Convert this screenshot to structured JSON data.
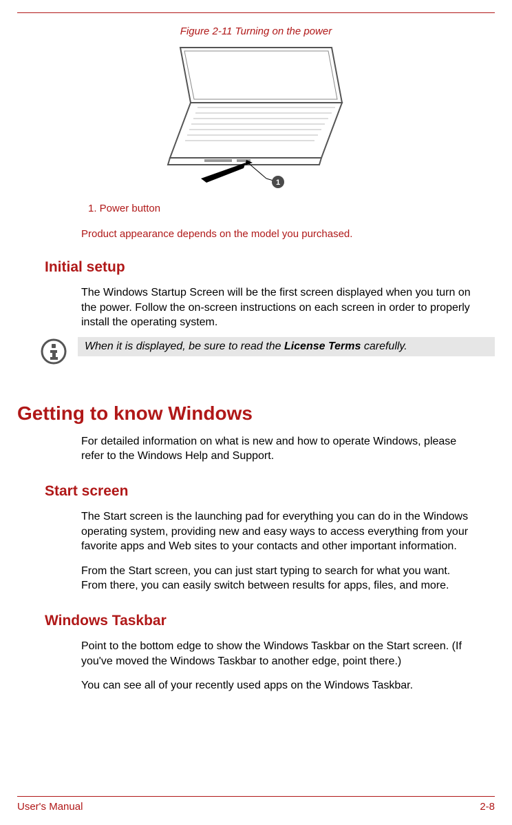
{
  "figure": {
    "caption": "Figure 2-11 Turning on the power",
    "callout_number": "1",
    "callout_label": "1. Power button"
  },
  "appearance_note": "Product appearance depends on the model you purchased.",
  "sections": {
    "initial_setup": {
      "title": "Initial setup",
      "para": "The Windows Startup Screen will be the first screen displayed when you turn on the power. Follow the on-screen instructions on each screen in order to properly install the operating system.",
      "info_prefix": "When it is displayed, be sure to read the ",
      "info_bold": "License Terms",
      "info_suffix": " carefully."
    },
    "getting_to_know": {
      "title": "Getting to know Windows",
      "para": "For detailed information on what is new and how to operate Windows, please refer to the Windows Help and Support."
    },
    "start_screen": {
      "title": "Start screen",
      "para1": "The Start screen is the launching pad for everything you can do in the Windows operating system, providing new and easy ways to access everything from your favorite apps and Web sites to your contacts and other important information.",
      "para2": "From the Start screen, you can just start typing to search for what you want. From there, you can easily switch between results for apps, files, and more."
    },
    "windows_taskbar": {
      "title": "Windows Taskbar",
      "para1": "Point to the bottom edge to show the Windows Taskbar on the Start screen. (If you've moved the Windows Taskbar to another edge, point there.)",
      "para2": "You can see all of your recently used apps on the Windows Taskbar."
    }
  },
  "footer": {
    "left": "User's Manual",
    "right": "2-8"
  }
}
